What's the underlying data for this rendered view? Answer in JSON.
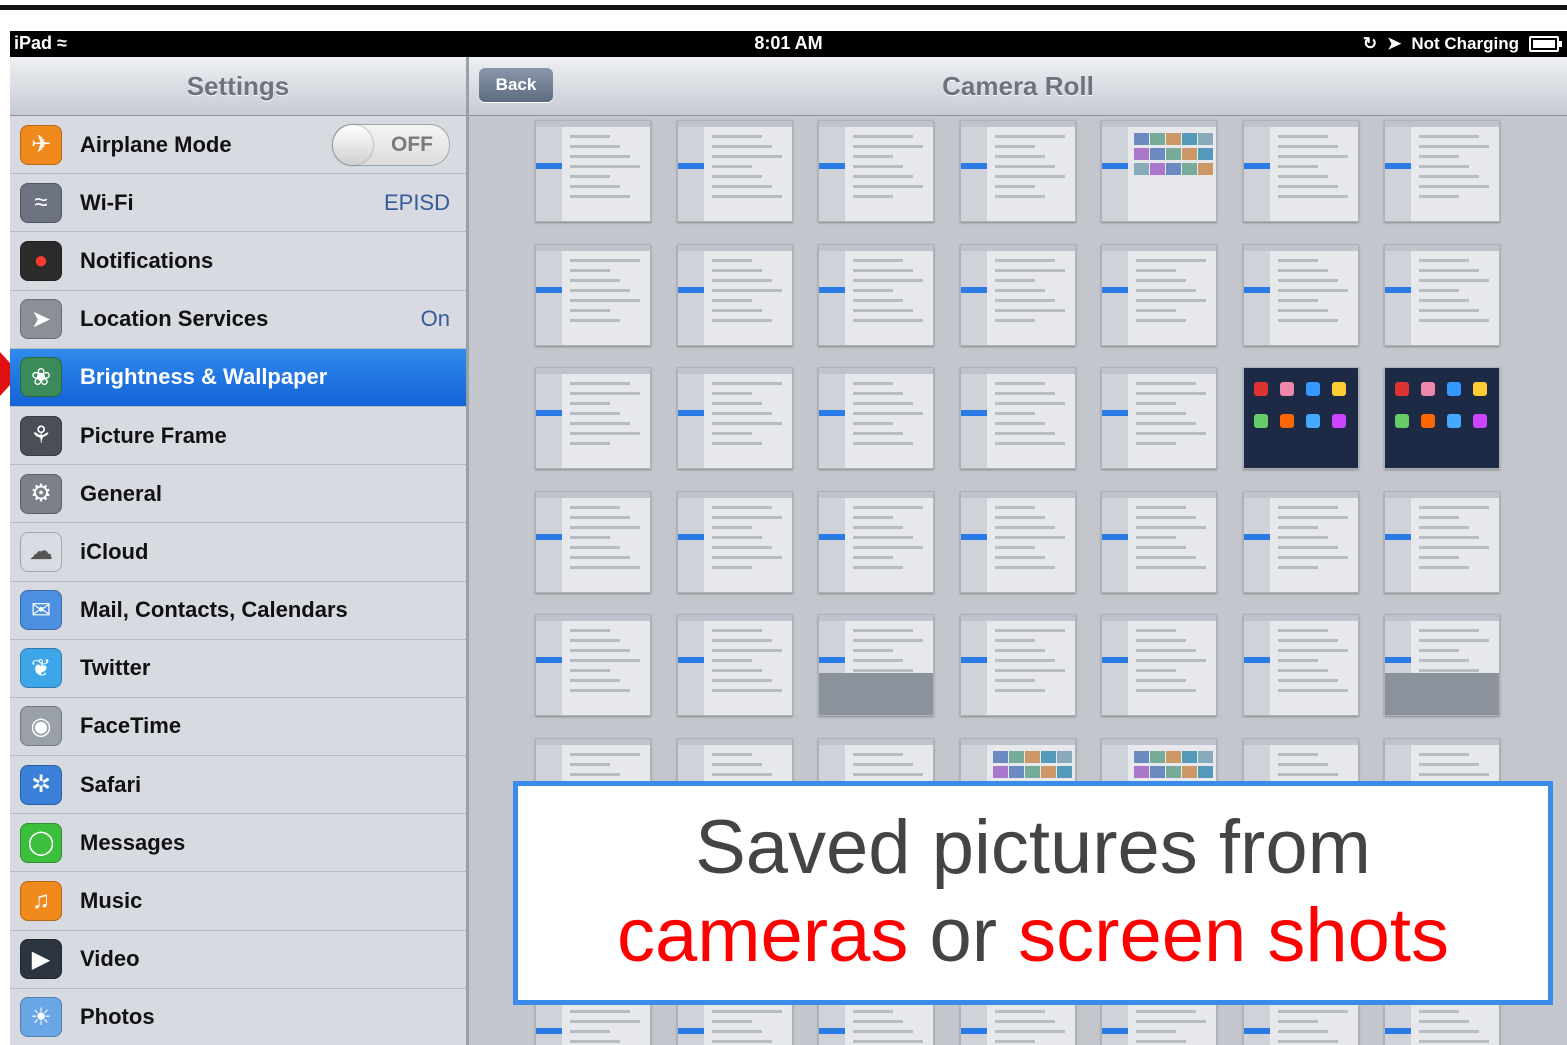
{
  "status_bar": {
    "device": "iPad",
    "time": "8:01 AM",
    "charging": "Not Charging"
  },
  "settings_panel": {
    "title": "Settings",
    "items": [
      {
        "label": "Airplane Mode",
        "value": "OFF",
        "icon": "airplane-icon",
        "color": "#f08a1c",
        "selected": false,
        "toggle": true
      },
      {
        "label": "Wi-Fi",
        "value": "EPISD",
        "icon": "wifi-icon",
        "color": "#6d7380",
        "selected": false
      },
      {
        "label": "Notifications",
        "value": "",
        "icon": "notifications-icon",
        "color": "#2b2b2b",
        "selected": false
      },
      {
        "label": "Location Services",
        "value": "On",
        "icon": "location-arrow-icon",
        "color": "#8a8f98",
        "selected": false
      },
      {
        "label": "Brightness & Wallpaper",
        "value": "",
        "icon": "flower-icon",
        "color": "#3a8a5a",
        "selected": true
      },
      {
        "label": "Picture Frame",
        "value": "",
        "icon": "picture-frame-icon",
        "color": "#4a4f57",
        "selected": false
      },
      {
        "label": "General",
        "value": "",
        "icon": "gear-icon",
        "color": "#7b8089",
        "selected": false
      },
      {
        "label": "iCloud",
        "value": "",
        "icon": "cloud-icon",
        "color": "#d9dde3",
        "selected": false
      },
      {
        "label": "Mail, Contacts, Calendars",
        "value": "",
        "icon": "mail-icon",
        "color": "#4c8fe0",
        "selected": false
      },
      {
        "label": "Twitter",
        "value": "",
        "icon": "twitter-bird-icon",
        "color": "#3da6e8",
        "selected": false
      },
      {
        "label": "FaceTime",
        "value": "",
        "icon": "facetime-camera-icon",
        "color": "#9aa0a8",
        "selected": false
      },
      {
        "label": "Safari",
        "value": "",
        "icon": "safari-compass-icon",
        "color": "#3a7fd8",
        "selected": false
      },
      {
        "label": "Messages",
        "value": "",
        "icon": "messages-bubble-icon",
        "color": "#3cbf3c",
        "selected": false
      },
      {
        "label": "Music",
        "value": "",
        "icon": "music-note-icon",
        "color": "#f08a1c",
        "selected": false
      },
      {
        "label": "Video",
        "value": "",
        "icon": "video-clapper-icon",
        "color": "#2c3440",
        "selected": false
      },
      {
        "label": "Photos",
        "value": "",
        "icon": "sunflower-icon",
        "color": "#6aa7e6",
        "selected": false
      }
    ]
  },
  "camera_roll": {
    "title": "Camera Roll",
    "back_label": "Back"
  },
  "callout": {
    "line1": "Saved pictures from",
    "word_cameras": "cameras",
    "word_or": " or ",
    "word_screenshots": "screen shots"
  },
  "colors": {
    "selected_row": "#1462d8",
    "callout_border": "#3b8bea",
    "highlight_text": "#ff0000"
  }
}
